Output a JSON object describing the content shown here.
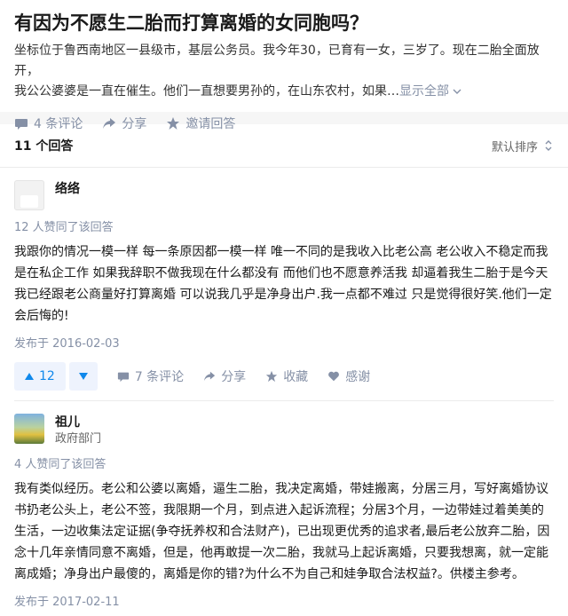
{
  "question": {
    "title": "有因为不愿生二胎而打算离婚的女同胞吗？",
    "detail_line1": "坐标位于鲁西南地区一县级市，基层公务员。我今年30，已育有一女，三岁了。现在二胎全面放开，",
    "detail_line2": "我公公婆婆是一直在催生。他们一直想要男孙的，在山东农村，如果…",
    "show_all": "显示全部",
    "comments": "4 条评论",
    "share": "分享",
    "invite": "邀请回答"
  },
  "answers_header": {
    "count": "11 个回答",
    "sort": "默认排序"
  },
  "answers": [
    {
      "author": "络络",
      "author_title": "",
      "votes_text": "12 人赞同了该回答",
      "content": "我跟你的情况一模一样 每一条原因都一模一样 唯一不同的是我收入比老公高 老公收入不稳定而我是在私企工作 如果我辞职不做我现在什么都没有 而他们也不愿意养活我 却逼着我生二胎于是今天我已经跟老公商量好打算离婚 可以说我几乎是净身出户.我一点都不难过 只是觉得很好笑.他们一定会后悔的!",
      "date": "发布于 2016-02-03",
      "upvotes": "12",
      "comments": "7 条评论",
      "share": "分享",
      "collect": "收藏",
      "thanks": "感谢"
    },
    {
      "author": "祖儿",
      "author_title": "政府部门",
      "votes_text": "4 人赞同了该回答",
      "content": "我有类似经历。老公和公婆以离婚，逼生二胎，我决定离婚，带娃搬离，分居三月，写好离婚协议书扔老公头上，老公不签，我限期一个月，到点进入起诉流程；分居3个月，一边带娃过着美美的生活，一边收集法定证据(争夺抚养权和合法财产)，已出现更优秀的追求者,最后老公放弃二胎，因念十几年亲情同意不离婚，但是，他再敢提一次二胎，我就马上起诉离婚，只要我想离，就一定能离成婚；净身出户最傻的，离婚是你的错?为什么不为自己和娃争取合法权益?。供楼主参考。",
      "date": "发布于 2017-02-11"
    }
  ],
  "colors": {
    "accent": "#0f88eb",
    "muted": "#8590a6"
  }
}
